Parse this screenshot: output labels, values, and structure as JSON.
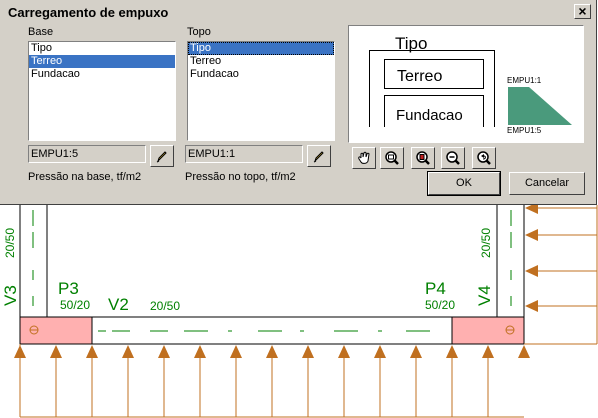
{
  "window": {
    "title": "Carregamento de empuxo",
    "close_glyph": "×"
  },
  "base": {
    "label": "Base",
    "items": [
      "Tipo",
      "Terreo",
      "Fundacao"
    ],
    "selected_index": 1,
    "value": "EMPU1:5",
    "caption": "Pressão na base, tf/m2"
  },
  "topo": {
    "label": "Topo",
    "items": [
      "Tipo",
      "Terreo",
      "Fundacao"
    ],
    "selected_index": 0,
    "value": "EMPU1:1",
    "caption": "Pressão no topo, tf/m2"
  },
  "preview": {
    "level_top": "Tipo",
    "level_mid": "Terreo",
    "level_bottom": "Fundacao",
    "top_label": "EMPU1:1",
    "bottom_label": "EMPU1:5",
    "diagram_color": "#4a9a7c"
  },
  "toolbar": {
    "icons": [
      "pan-hand-icon",
      "zoom-window-icon",
      "zoom-all-icon",
      "zoom-out-icon",
      "zoom-previous-icon"
    ]
  },
  "buttons": {
    "ok": "OK",
    "cancel": "Cancelar"
  },
  "drawing": {
    "column_left_name": "V3",
    "column_left_dim": "20/50",
    "column_right_name": "V4",
    "column_right_dim": "20/50",
    "pillar_left_name": "P3",
    "pillar_left_dim": "50/20",
    "pillar_right_name": "P4",
    "pillar_right_dim": "50/20",
    "beam_name": "V2",
    "beam_dim": "20/50",
    "colors": {
      "line": "#000000",
      "axis": "#008000",
      "load": "#c07020",
      "pillar_fill": "#ffb0b0"
    }
  }
}
